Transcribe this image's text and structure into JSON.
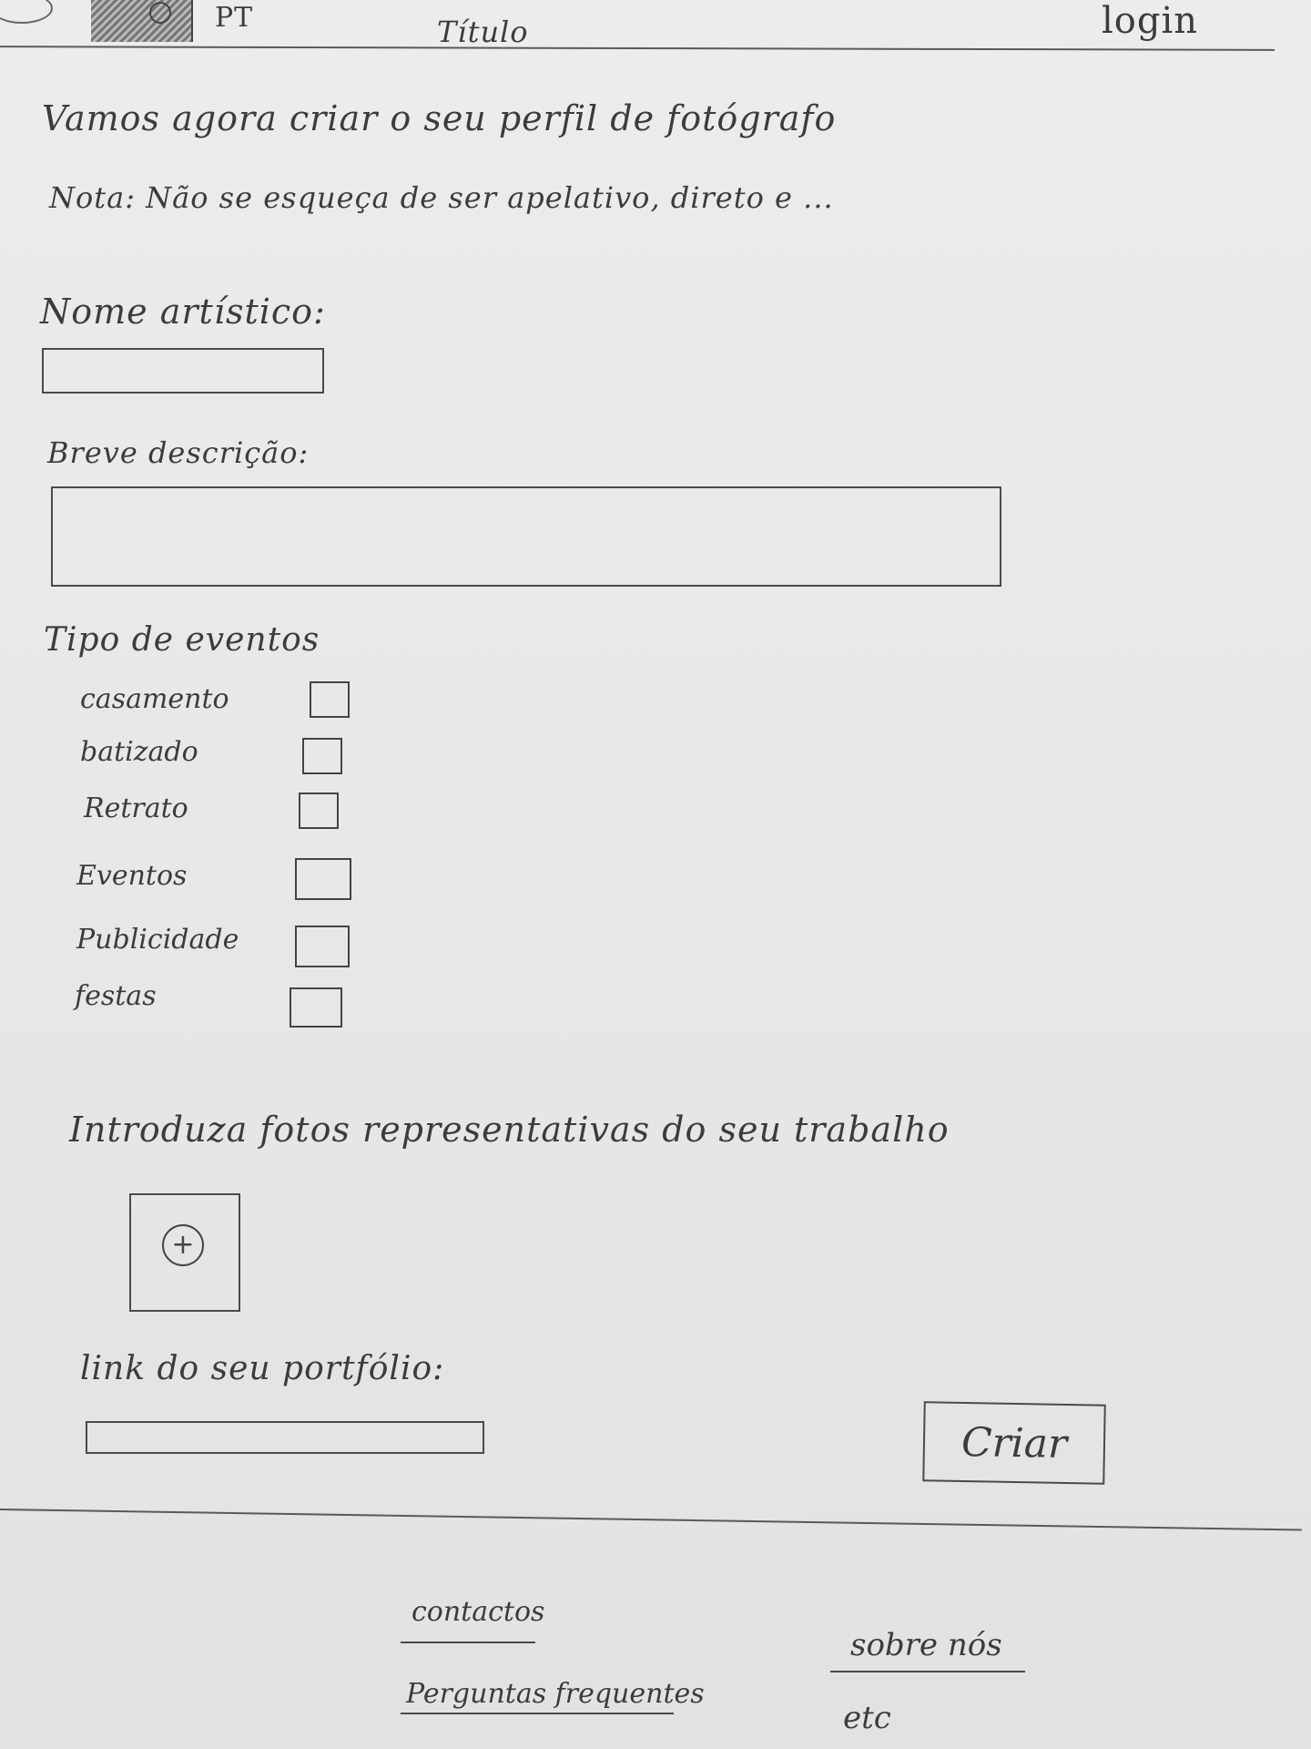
{
  "header": {
    "language": "PT",
    "title": "Título",
    "login_label": "login"
  },
  "intro": {
    "heading": "Vamos agora criar o seu perfil de fotógrafo",
    "note": "Nota: Não se esqueça de ser apelativo, direto e ..."
  },
  "form": {
    "artistic_name_label": "Nome artístico:",
    "artistic_name_value": "",
    "description_label": "Breve descrição:",
    "description_value": "",
    "event_types_label": "Tipo de eventos",
    "event_types": [
      {
        "label": "casamento",
        "checked": false
      },
      {
        "label": "batizado",
        "checked": false
      },
      {
        "label": "Retrato",
        "checked": false
      },
      {
        "label": "Eventos",
        "checked": false
      },
      {
        "label": "Publicidade",
        "checked": false
      },
      {
        "label": "festas",
        "checked": false
      }
    ],
    "photos_label": "Introduza fotos representativas do seu trabalho",
    "add_photo_glyph": "+",
    "portfolio_label": "link do seu portfólio:",
    "portfolio_value": "",
    "submit_label": "Criar"
  },
  "footer": {
    "links": [
      "contactos",
      "Perguntas frequentes",
      "sobre nós",
      "etc"
    ]
  }
}
